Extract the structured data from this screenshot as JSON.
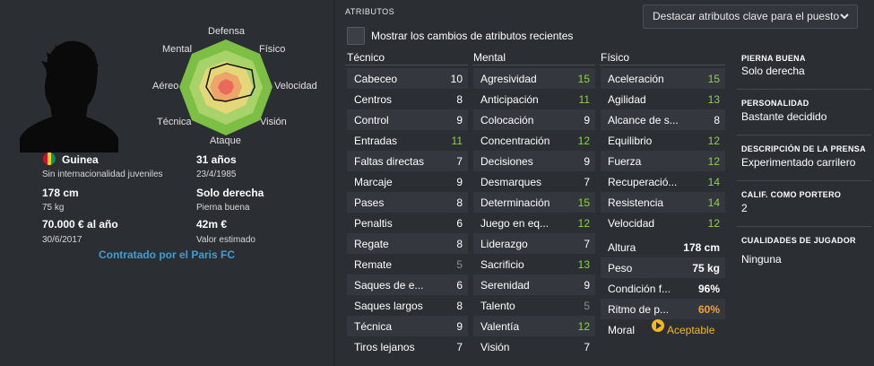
{
  "player": {
    "nationality": "Guinea",
    "international_status": "Sin internacionalidad juveniles",
    "age": "31 años",
    "birth_date": "23/4/1985",
    "height": "178 cm",
    "weight": "75 kg",
    "foot_value": "Solo derecha",
    "foot_label": "Pierna buena",
    "wage": "70.000 € al año",
    "contract_end": "30/6/2017",
    "value": "42m €",
    "value_label": "Valor estimado",
    "contract_status": "Contratado por el Paris FC"
  },
  "radar": {
    "labels": {
      "defensa": "Defensa",
      "fisico": "Físico",
      "velocidad": "Velocidad",
      "vision": "Visión",
      "ataque": "Ataque",
      "tecnica": "Técnica",
      "aereo": "Aéreo",
      "mental": "Mental"
    }
  },
  "attributes_panel": {
    "title": "ATRIBUTOS",
    "dropdown": "Destacar atributos clave para el puesto",
    "checkbox_label": "Mostrar los cambios de atributos recientes",
    "columns": {
      "tecnico": "Técnico",
      "mental": "Mental",
      "fisico": "Físico"
    },
    "tecnico": [
      {
        "name": "Cabeceo",
        "value": "10",
        "color": "white"
      },
      {
        "name": "Centros",
        "value": "8",
        "color": "white"
      },
      {
        "name": "Control",
        "value": "9",
        "color": "white"
      },
      {
        "name": "Entradas",
        "value": "11",
        "color": "green"
      },
      {
        "name": "Faltas directas",
        "value": "7",
        "color": "white"
      },
      {
        "name": "Marcaje",
        "value": "9",
        "color": "white"
      },
      {
        "name": "Pases",
        "value": "8",
        "color": "white"
      },
      {
        "name": "Penaltis",
        "value": "6",
        "color": "white"
      },
      {
        "name": "Regate",
        "value": "8",
        "color": "white"
      },
      {
        "name": "Remate",
        "value": "5",
        "color": "grey"
      },
      {
        "name": "Saques de e...",
        "value": "6",
        "color": "white"
      },
      {
        "name": "Saques largos",
        "value": "8",
        "color": "white"
      },
      {
        "name": "Técnica",
        "value": "9",
        "color": "white"
      },
      {
        "name": "Tiros lejanos",
        "value": "7",
        "color": "white"
      }
    ],
    "mental": [
      {
        "name": "Agresividad",
        "value": "15",
        "color": "green"
      },
      {
        "name": "Anticipación",
        "value": "11",
        "color": "green"
      },
      {
        "name": "Colocación",
        "value": "9",
        "color": "white"
      },
      {
        "name": "Concentración",
        "value": "12",
        "color": "green"
      },
      {
        "name": "Decisiones",
        "value": "9",
        "color": "white"
      },
      {
        "name": "Desmarques",
        "value": "7",
        "color": "white"
      },
      {
        "name": "Determinación",
        "value": "15",
        "color": "green"
      },
      {
        "name": "Juego en eq...",
        "value": "12",
        "color": "green"
      },
      {
        "name": "Liderazgo",
        "value": "7",
        "color": "white"
      },
      {
        "name": "Sacrificio",
        "value": "13",
        "color": "green"
      },
      {
        "name": "Serenidad",
        "value": "9",
        "color": "white"
      },
      {
        "name": "Talento",
        "value": "5",
        "color": "grey"
      },
      {
        "name": "Valentía",
        "value": "12",
        "color": "green"
      },
      {
        "name": "Visión",
        "value": "7",
        "color": "white"
      }
    ],
    "fisico": [
      {
        "name": "Aceleración",
        "value": "15",
        "color": "green"
      },
      {
        "name": "Agilidad",
        "value": "13",
        "color": "green"
      },
      {
        "name": "Alcance de s...",
        "value": "8",
        "color": "white"
      },
      {
        "name": "Equilibrio",
        "value": "12",
        "color": "green"
      },
      {
        "name": "Fuerza",
        "value": "12",
        "color": "green"
      },
      {
        "name": "Recuperació...",
        "value": "14",
        "color": "green"
      },
      {
        "name": "Resistencia",
        "value": "14",
        "color": "green"
      },
      {
        "name": "Velocidad",
        "value": "12",
        "color": "green"
      }
    ],
    "fisico_extra": [
      {
        "name": "Altura",
        "value": "178 cm",
        "color": "white"
      },
      {
        "name": "Peso",
        "value": "75 kg",
        "color": "white"
      },
      {
        "name": "Condición f...",
        "value": "96%",
        "color": "white"
      },
      {
        "name": "Ritmo de p...",
        "value": "60%",
        "color": "orange"
      },
      {
        "name": "Moral",
        "value": "Aceptable",
        "color": "gold"
      }
    ]
  },
  "side": {
    "foot_title": "PIERNA BUENA",
    "foot_value": "Solo derecha",
    "personality_title": "PERSONALIDAD",
    "personality_value": "Bastante decidido",
    "press_title": "DESCRIPCIÓN DE LA PRENSA",
    "press_value": "Experimentado carrilero",
    "gk_title": "CALIF. COMO PORTERO",
    "gk_value": "2",
    "qualities_title": "CUALIDADES DE JUGADOR",
    "qualities_value": "Ninguna"
  },
  "colors": {
    "green": "#8fd24a",
    "grey": "#8b8e93",
    "orange": "#f0a23a",
    "gold": "#f2b81c",
    "link": "#3aa0d8"
  }
}
